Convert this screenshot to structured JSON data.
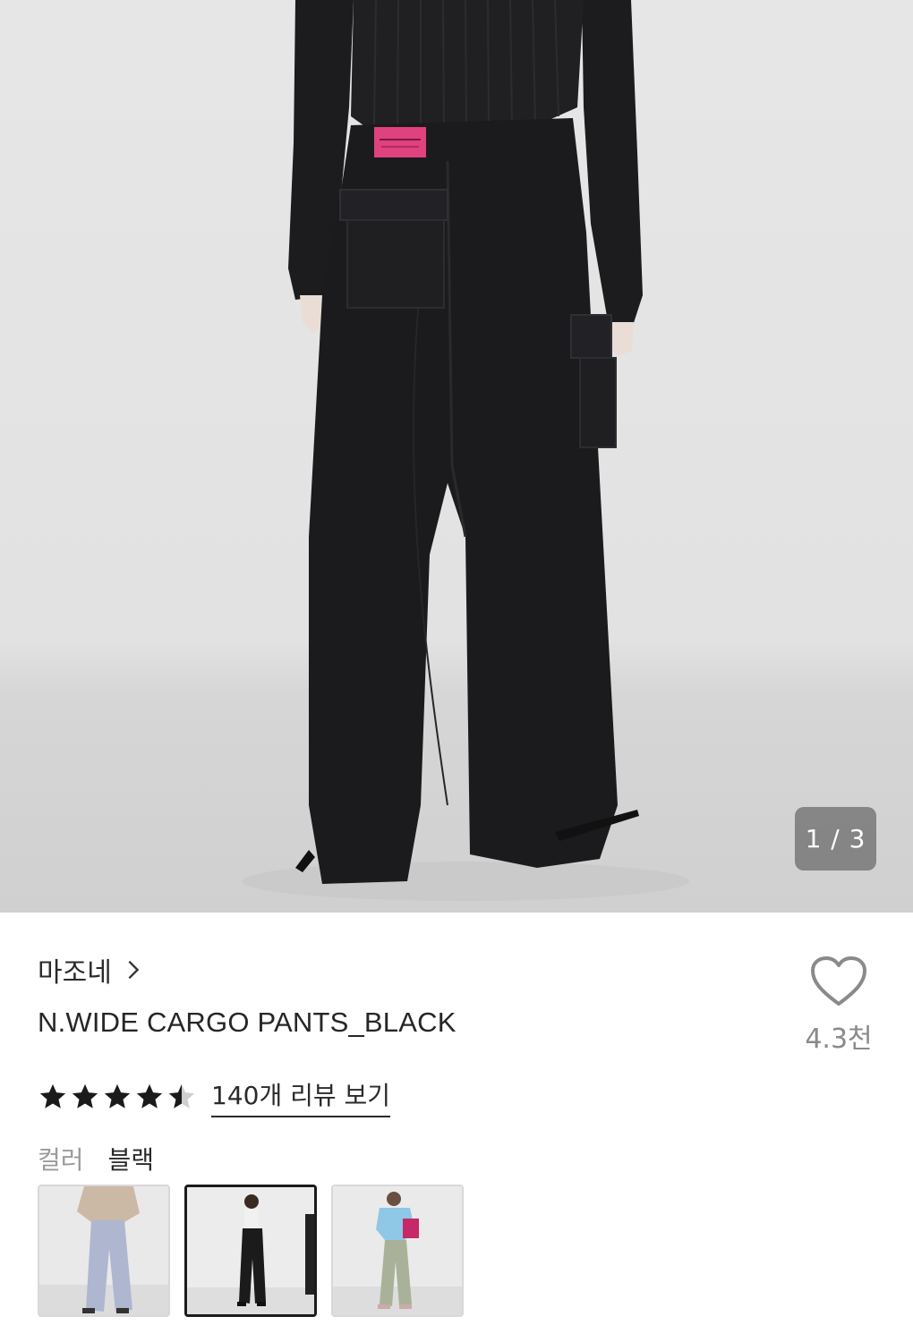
{
  "gallery": {
    "current": 1,
    "total": 3,
    "counter_text": "1 / 3"
  },
  "product": {
    "brand": "마조네",
    "title": "N.WIDE CARGO PANTS_BLACK",
    "rating": 4.5,
    "review_link": "140개 리뷰 보기",
    "like_count": "4.3천"
  },
  "options": {
    "color_label": "컬러",
    "color_value": "블랙",
    "swatches": [
      {
        "name": "light-blue",
        "selected": false
      },
      {
        "name": "black",
        "selected": true
      },
      {
        "name": "khaki",
        "selected": false
      }
    ]
  },
  "icons": {
    "brand_chevron": "chevron-right-icon",
    "like": "heart-outline-icon",
    "star": "star-icon"
  }
}
